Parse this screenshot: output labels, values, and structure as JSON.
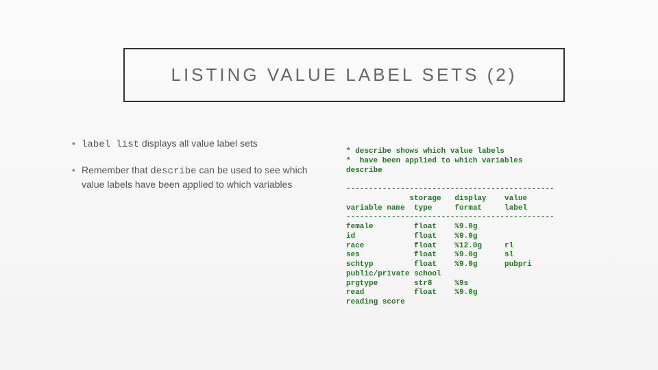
{
  "title": "LISTING VALUE LABEL SETS (2)",
  "bullets": {
    "b1_code": "label list",
    "b1_rest": " displays all value label sets",
    "b2_pre": "Remember that ",
    "b2_code": "describe",
    "b2_post": " can be used to see which value labels have been applied to which variables"
  },
  "stata_output": "* describe shows which value labels\n*  have been applied to which variables\ndescribe\n\n----------------------------------------------\n              storage   display    value\nvariable name  type     format     label\n----------------------------------------------\nfemale         float    %9.0g\nid             float    %9.0g\nrace           float    %12.0g     rl\nses            float    %9.0g      sl\nschtyp         float    %9.0g      pubpri\npublic/private school\nprgtype        str8     %9s\nread           float    %9.0g\nreading score"
}
